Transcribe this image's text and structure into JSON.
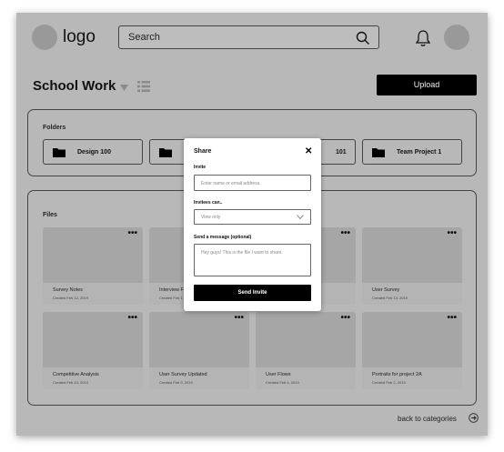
{
  "header": {
    "logo_text": "logo",
    "search_label": "Search"
  },
  "page": {
    "title": "School Work",
    "upload_label": "Upload"
  },
  "folders": {
    "title": "Folders",
    "items": [
      {
        "label": "Design 100"
      },
      {
        "label": "C"
      },
      {
        "label": "101"
      },
      {
        "label": "Team Project 1"
      }
    ]
  },
  "files": {
    "title": "Files",
    "more_label": "•••",
    "items": [
      {
        "name": "Survey Notes",
        "date": "Created Feb 12, 2019"
      },
      {
        "name": "Interview F",
        "date": "Created Feb 1"
      },
      {
        "name": "",
        "date": ""
      },
      {
        "name": "User Survey",
        "date": "Created Feb 13, 2019"
      },
      {
        "name": "Competitive Analysis",
        "date": "Created Feb 10, 2019"
      },
      {
        "name": "User Survey Updated",
        "date": "Created Feb 9, 2019"
      },
      {
        "name": "User Flows",
        "date": "Created Feb 4, 2019"
      },
      {
        "name": "Portraits for project 2A",
        "date": "Created Feb 2, 2019"
      }
    ]
  },
  "footer": {
    "back_label": "back to categories"
  },
  "modal": {
    "title": "Share",
    "close_label": "✕",
    "invite_label": "Invite",
    "invite_placeholder": "Enter name or email address.",
    "invitees_label": "Invitees can..",
    "permission_value": "View only",
    "message_label": "Send a message (optional)",
    "message_placeholder": "Hey guys! This is the file I want to share.",
    "send_label": "Send Invite"
  }
}
